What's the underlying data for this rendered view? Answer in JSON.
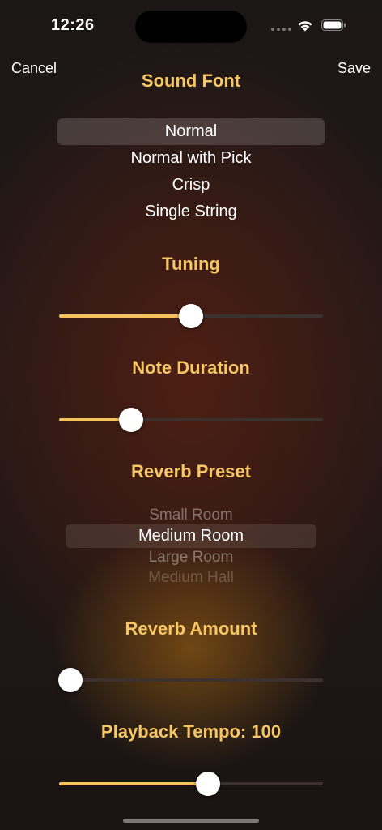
{
  "status_bar": {
    "time": "12:26"
  },
  "nav": {
    "cancel": "Cancel",
    "save": "Save"
  },
  "sound_font": {
    "title": "Sound Font",
    "options": [
      "Normal",
      "Normal with Pick",
      "Crisp",
      "Single String"
    ],
    "selected": "Normal"
  },
  "tuning": {
    "title": "Tuning",
    "value_fraction": 0.5
  },
  "note_duration": {
    "title": "Note Duration",
    "value_fraction": 0.27
  },
  "reverb_preset": {
    "title": "Reverb Preset",
    "options": [
      "Small Room",
      "Medium Room",
      "Large Room",
      "Medium Hall"
    ],
    "selected": "Medium Room"
  },
  "reverb_amount": {
    "title": "Reverb Amount",
    "value_fraction": 0.0
  },
  "playback_tempo": {
    "title": "Playback Tempo: 100",
    "value_fraction": 0.57
  },
  "colors": {
    "accent": "#f7c664",
    "slider_fill": "#f6c25e",
    "track": "#3b3230"
  }
}
